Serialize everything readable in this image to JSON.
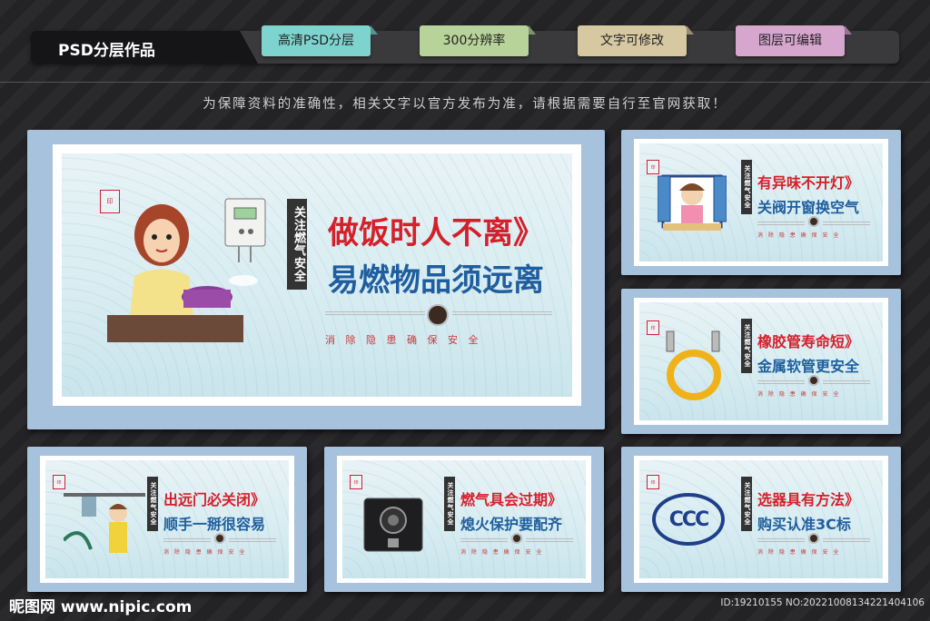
{
  "header": {
    "brand": "PSD分层作品",
    "tags": [
      {
        "label": "高清PSD分层",
        "color": "#7fd3cf"
      },
      {
        "label": "300分辨率",
        "color": "#b7d39a"
      },
      {
        "label": "文字可修改",
        "color": "#d6c8a0"
      },
      {
        "label": "图层可编辑",
        "color": "#d7a6cf"
      }
    ]
  },
  "notice": "为保障资料的准确性，相关文字以官方发布为准，请根据需要自行至官网获取！",
  "boards": {
    "main": {
      "vertical": "关注燃气安全",
      "title_red": "做饭时人不离》",
      "title_blue": "易燃物品须远离",
      "slogan": "消 除 隐 患   确 保 安 全"
    },
    "b1": {
      "vertical": "关注燃气安全",
      "title_red": "有异味不开灯》",
      "title_blue": "关阀开窗换空气",
      "slogan": "消 除 隐 患   确 保 安 全"
    },
    "b2": {
      "vertical": "关注燃气安全",
      "title_red": "橡胶管寿命短》",
      "title_blue": "金属软管更安全",
      "slogan": "消 除 隐 患   确 保 安 全"
    },
    "b3": {
      "vertical": "关注燃气安全",
      "title_red": "出远门必关闭》",
      "title_blue": "顺手一掰很容易",
      "slogan": "消 除 隐 患   确 保 安 全"
    },
    "b4": {
      "vertical": "关注燃气安全",
      "title_red": "燃气具会过期》",
      "title_blue": "熄火保护要配齐",
      "slogan": "消 除 隐 患   确 保 安 全"
    },
    "b5": {
      "vertical": "关注燃气安全",
      "title_red": "选器具有方法》",
      "title_blue": "购买认准3C标",
      "slogan": "消 除 隐 患   确 保 安 全",
      "ccc": "CCC"
    }
  },
  "footer": {
    "logo": "昵图网 www.nipic.com",
    "id": "ID:19210155 NO:20221008134221404106"
  }
}
